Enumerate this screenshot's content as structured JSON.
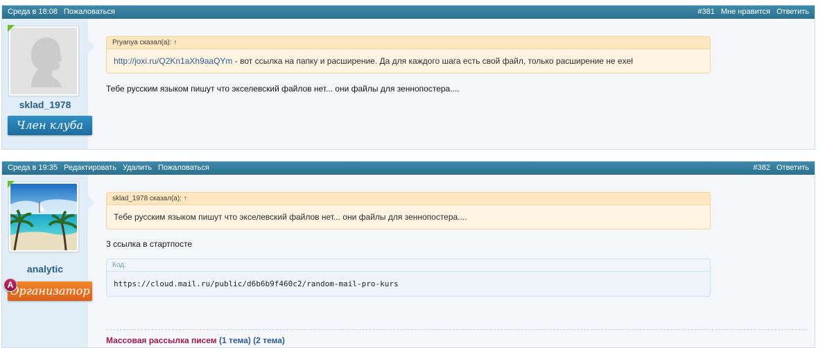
{
  "posts": [
    {
      "header": {
        "date": "Среда в 18:08",
        "actions": [
          "Пожаловаться"
        ],
        "number": "#381",
        "like": "Мне нравится",
        "reply": "Ответить"
      },
      "author": {
        "username": "sklad_1978",
        "title": "Член клуба",
        "avatar": "default-silhouette"
      },
      "quote": {
        "header": "Pryanya сказал(а): ↑",
        "link": "http://joxi.ru/Q2Kn1aXh9aaQYm",
        "text": " - вот ссылка на папку и расширение. Да для каждого шага есть свой файл, только расширение не exel"
      },
      "message": "Тебе русским языком пишут что экселевский файлов нет... они файлы для зеннопостера...."
    },
    {
      "header": {
        "date": "Среда в 19:35",
        "actions": [
          "Редактировать",
          "Удалить",
          "Пожаловаться"
        ],
        "number": "#382",
        "reply": "Ответить"
      },
      "author": {
        "username": "analytic",
        "title": "Организатор",
        "badge": "A",
        "avatar": "tropical-beach"
      },
      "quote": {
        "header": "sklad_1978 сказал(а): ↑",
        "text": "Тебе русским языком пишут что экселевский файлов нет... они файлы для зеннопостера...."
      },
      "message": "3 ссылка в стартпосте",
      "code": {
        "label": "Код:",
        "content": "https://cloud.mail.ru/public/d6b6b9f460c2/random-mail-pro-kurs"
      },
      "signature": {
        "text": "Массовая рассылка писем",
        "link1": "(1 тема)",
        "link2": "(2 тема)"
      }
    }
  ],
  "colors": {
    "header_bg": "#3480a1",
    "side_bg": "#e2eef7",
    "post_bg": "#f4f6fa",
    "quote_bg": "#fff4e2",
    "link": "#2f5c90",
    "member_ribbon": "#2279b0",
    "organizer_ribbon": "#e8731f"
  }
}
